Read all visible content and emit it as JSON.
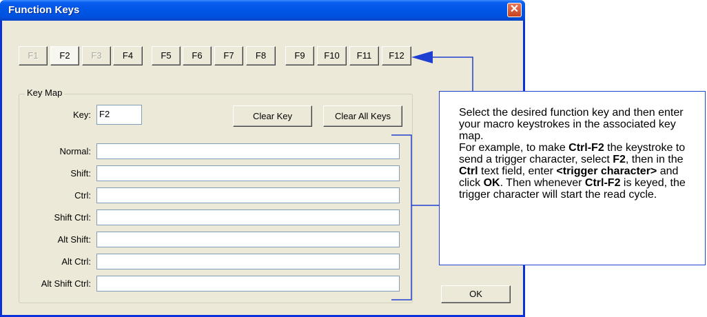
{
  "window": {
    "title": "Function Keys"
  },
  "fkeys": [
    {
      "label": "F1",
      "state": "disabled"
    },
    {
      "label": "F2",
      "state": "selected"
    },
    {
      "label": "F3",
      "state": "disabled"
    },
    {
      "label": "F4",
      "state": "normal"
    },
    {
      "label": "F5",
      "state": "normal"
    },
    {
      "label": "F6",
      "state": "normal"
    },
    {
      "label": "F7",
      "state": "normal"
    },
    {
      "label": "F8",
      "state": "normal"
    },
    {
      "label": "F9",
      "state": "normal"
    },
    {
      "label": "F10",
      "state": "normal"
    },
    {
      "label": "F11",
      "state": "normal"
    },
    {
      "label": "F12",
      "state": "normal"
    }
  ],
  "keymap": {
    "legend": "Key Map",
    "key_label": "Key:",
    "key_value": "F2",
    "clear_key": "Clear Key",
    "clear_all": "Clear All Keys",
    "rows": [
      {
        "label": "Normal:",
        "value": ""
      },
      {
        "label": "Shift:",
        "value": ""
      },
      {
        "label": "Ctrl:",
        "value": ""
      },
      {
        "label": "Shift Ctrl:",
        "value": ""
      },
      {
        "label": "Alt Shift:",
        "value": ""
      },
      {
        "label": "Alt Ctrl:",
        "value": ""
      },
      {
        "label": "Alt Shift Ctrl:",
        "value": ""
      }
    ]
  },
  "ok_label": "OK",
  "callout": {
    "p1": "Select the desired function key and then enter your macro keystrokes in the associated key map.",
    "p2_a": "For example, to make ",
    "p2_b": "Ctrl-F2",
    "p2_c": " the keystroke to send a trigger character, select ",
    "p2_d": "F2",
    "p2_e": ", then in the ",
    "p2_f": "Ctrl",
    "p2_g": " text field, enter ",
    "p2_h": "<trigger character>",
    "p2_i": " and click ",
    "p2_j": "OK",
    "p2_k": ". Then whenever ",
    "p2_l": "Ctrl-F2",
    "p2_m": " is keyed, the trigger character will start the read cycle."
  },
  "colors": {
    "accent_line": "#1f3fd0",
    "titlebar": "#0053e2"
  }
}
